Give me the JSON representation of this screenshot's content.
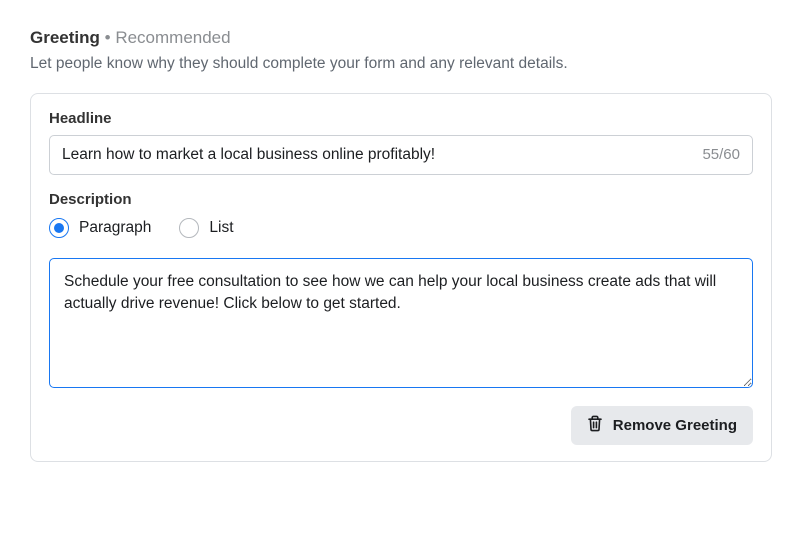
{
  "section": {
    "title": "Greeting",
    "subtitle_separator": " • ",
    "subtitle": "Recommended",
    "description": "Let people know why they should complete your form and any relevant details."
  },
  "headline": {
    "label": "Headline",
    "value": "Learn how to market a local business online profitably!",
    "counter": "55/60"
  },
  "description_field": {
    "label": "Description",
    "options": {
      "paragraph": "Paragraph",
      "list": "List"
    },
    "selected": "paragraph",
    "value": "Schedule your free consultation to see how we can help your local business create ads that will actually drive revenue! Click below to get started."
  },
  "footer": {
    "remove_label": "Remove Greeting"
  }
}
